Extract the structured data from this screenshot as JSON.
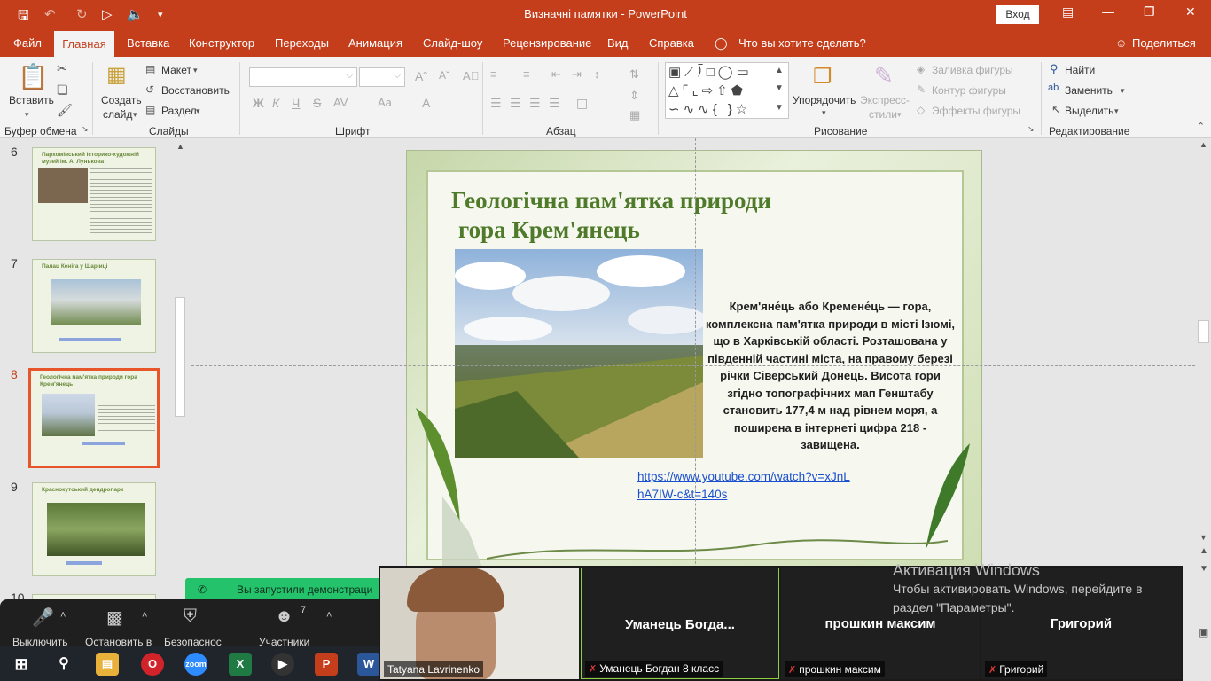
{
  "titlebar": {
    "title": "Визначні памятки  -  PowerPoint",
    "signin": "Вход"
  },
  "menu": {
    "tabs": [
      "Файл",
      "Главная",
      "Вставка",
      "Конструктор",
      "Переходы",
      "Анимация",
      "Слайд-шоу",
      "Рецензирование",
      "Вид",
      "Справка"
    ],
    "search": "Что вы хотите сделать?",
    "share": "Поделиться"
  },
  "ribbon": {
    "clipboard": {
      "paste": "Вставить",
      "group": "Буфер обмена"
    },
    "slides": {
      "new_slide": "Создать",
      "new_slide2": "слайд",
      "layout": "Макет",
      "reset": "Восстановить",
      "section": "Раздел",
      "group": "Слайды"
    },
    "font": {
      "group": "Шрифт",
      "bold": "Ж",
      "italic": "К",
      "underline": "Ч",
      "strike": "S",
      "size_aa": "Aa"
    },
    "paragraph": {
      "group": "Абзац"
    },
    "drawing": {
      "arrange": "Упорядочить",
      "styles": "Экспресс-",
      "styles2": "стили",
      "fill": "Заливка фигуры",
      "outline": "Контур фигуры",
      "effects": "Эффекты фигуры",
      "group": "Рисование"
    },
    "editing": {
      "find": "Найти",
      "replace": "Заменить",
      "select": "Выделить",
      "group": "Редактирование"
    }
  },
  "thumbnails": [
    {
      "num": "6",
      "title": "Пархомівський історико-художній музей ім. А. Лунькова"
    },
    {
      "num": "7",
      "title": "Палац Кеніга у Шаріиці"
    },
    {
      "num": "8",
      "title": "Геологічна пам'ятка природи гора Крем'янець"
    },
    {
      "num": "9",
      "title": "Краснокутський дендропарк"
    },
    {
      "num": "10",
      "title": ""
    }
  ],
  "slide": {
    "title_line1": "Геологічна пам'ятка природи",
    "title_line2": "гора Крем'янець",
    "body": "Крем'яне́ць або Кремене́ць — гора, комплексна пам'ятка природи в місті Ізюмі, що в Харківській області. Розташована у південній частині міста, на правому березі річки Сіверський Донець. Висота гори згідно топографічних мап Генштабу становить 177,4 м над рівнем моря, а поширена в інтернеті цифра 218 - завищена.",
    "link_line1": "https://www.youtube.com/watch?v=xJnL",
    "link_line2": "hA7IW-c&t=140s"
  },
  "zoom": {
    "banner": "Вы запустили демонстраци",
    "mute": "Выключить",
    "video": "Остановить в",
    "security": "Безопаснос",
    "participants": "Участники",
    "participants_count": "7",
    "tiles": [
      {
        "name": "",
        "label": "Tatyana Lavrinenko"
      },
      {
        "name": "Уманець  Богда...",
        "label": "Уманець Богдан 8 класс"
      },
      {
        "name": "прошкин максим",
        "label": "прошкин максим"
      },
      {
        "name": "Григорий",
        "label": "Григорий"
      }
    ]
  },
  "activation": {
    "heading": "Активация Windows",
    "text": "Чтобы активировать Windows, перейдите в раздел \"Параметры\"."
  },
  "colors": {
    "accent": "#c43e1c",
    "zoom_green": "#23c26b",
    "slide_title": "#4e7a2a",
    "link": "#1a4fcf"
  }
}
